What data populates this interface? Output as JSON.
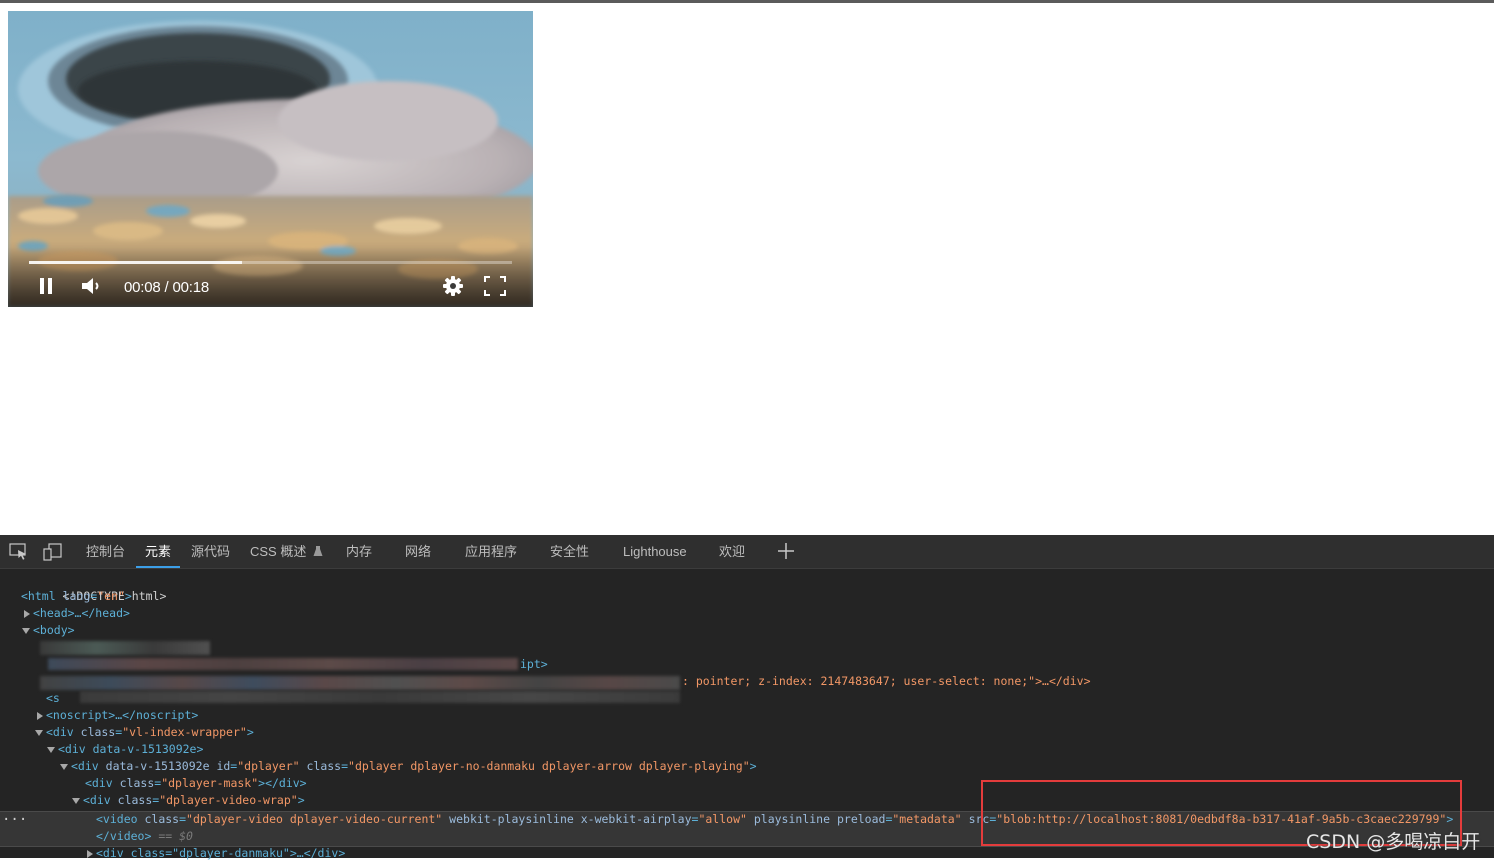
{
  "player": {
    "time_current": "00:08",
    "time_separator": " / ",
    "time_total": "00:18",
    "progress_fraction": 0.44
  },
  "devtools": {
    "tabs": [
      {
        "label": "控制台",
        "active": false
      },
      {
        "label": "元素",
        "active": true
      },
      {
        "label": "源代码",
        "active": false
      },
      {
        "label": "CSS 概述",
        "active": false
      },
      {
        "label": "内存",
        "active": false
      },
      {
        "label": "网络",
        "active": false
      },
      {
        "label": "应用程序",
        "active": false
      },
      {
        "label": "安全性",
        "active": false
      },
      {
        "label": "Lighthouse",
        "active": false
      },
      {
        "label": "欢迎",
        "active": false
      }
    ],
    "dom": {
      "doctype": "<!DOCTYPE html>",
      "html_open": "<html",
      "html_attr_name": "lang",
      "html_attr_value": "\"en\"",
      "head_collapsed": "<head>…</head>",
      "body_open": "<body>",
      "partial_script_tail": "ipt>",
      "partial_style_text": ": pointer; z-index: 2147483647; user-select: none;\">…</div>",
      "partial_s": "<s",
      "noscript": "<noscript>…</noscript>",
      "wrapper_tag": "<div",
      "wrapper_attr": "class",
      "wrapper_value": "\"vl-index-wrapper\"",
      "datav_div": "<div data-v-1513092e>",
      "dplayer_tag": "<div",
      "dplayer_attr1": "data-v-1513092e",
      "dplayer_attr2": "id",
      "dplayer_val2": "\"dplayer\"",
      "dplayer_attr3": "class",
      "dplayer_val3": "\"dplayer dplayer-no-danmaku dplayer-arrow dplayer-playing\"",
      "mask_tag": "<div",
      "mask_attr": "class",
      "mask_value": "\"dplayer-mask\"",
      "mask_close": "></div>",
      "videowrap_tag": "<div",
      "videowrap_attr": "class",
      "videowrap_value": "\"dplayer-video-wrap\"",
      "video_tag": "<video",
      "video_class_attr": "class",
      "video_class_val": "\"dplayer-video dplayer-video-current\"",
      "video_attr_pi": "webkit-playsinline",
      "video_attr_xwa": "x-webkit-airplay",
      "video_val_xwa": "\"allow\"",
      "video_attr_pis": "playsinline",
      "video_attr_preload": "preload",
      "video_val_preload": "\"metadata\"",
      "video_attr_src": "src",
      "video_val_src": "\"blob:http://localhost:8081/0edbdf8a-b317-41af-9a5b-c3caec229799\"",
      "video_close": "</video>",
      "video_ref": " == $0",
      "danmaku": "<div class=\"dplayer-danmaku\">…</div>",
      "gt": ">",
      "eq": "=",
      "ellipsis_dots": "···"
    }
  },
  "watermark": "CSDN @多喝凉白开",
  "colors": {
    "devtools_bg": "#242424",
    "tab_accent": "#3c9fe8",
    "highlight_box": "#e43c3c"
  }
}
